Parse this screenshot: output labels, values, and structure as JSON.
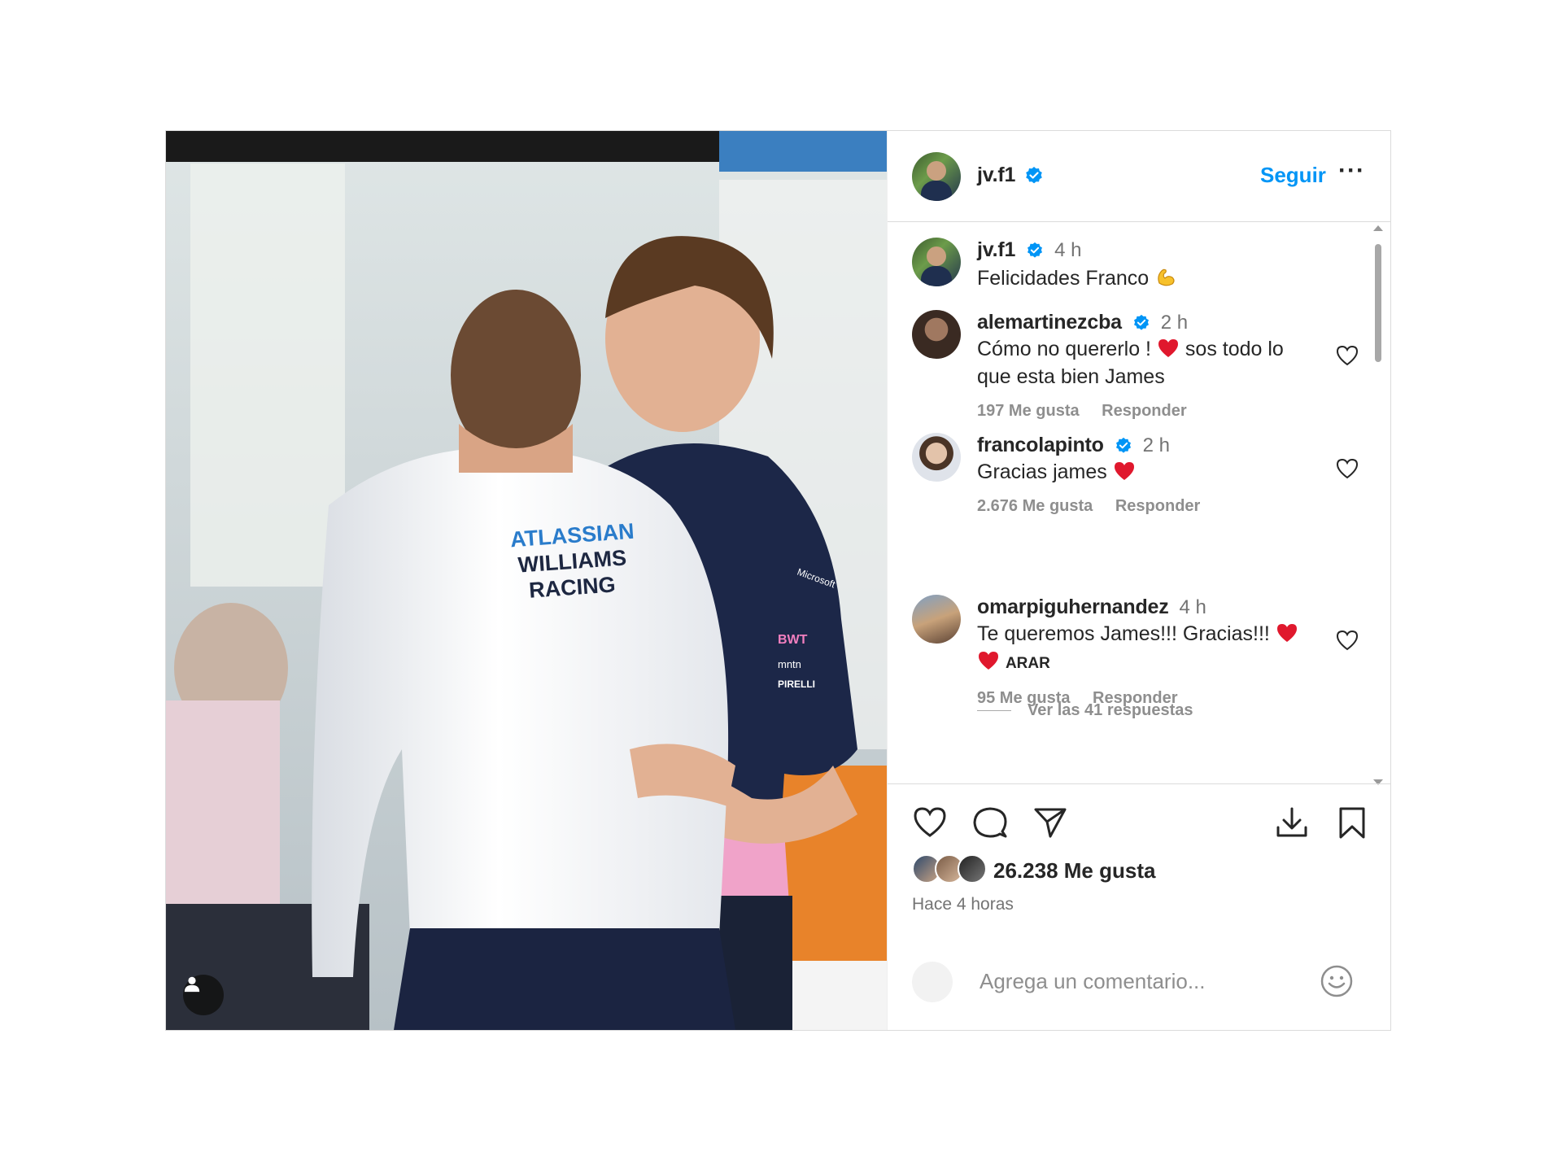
{
  "photo": {
    "shirt_text": [
      "ATLASSIAN",
      "WILLIAMS",
      "RACING"
    ],
    "sponsor_text": [
      "Microsoft",
      "BWT",
      "mntn",
      "PIRELLI"
    ],
    "tag_icon": "user-tag-icon"
  },
  "header": {
    "username": "jv.f1",
    "verified": true,
    "follow_label": "Seguir",
    "more_label": "···"
  },
  "caption": {
    "username": "jv.f1",
    "time": "4 h",
    "text": "Felicidades Franco",
    "emoji": "flexed-biceps-icon"
  },
  "comments": [
    {
      "username": "alemartinezcba",
      "verified": true,
      "time": "2 h",
      "text_part1": "Cómo no quererlo !",
      "text_part2": "sos todo lo",
      "text_line2": "que esta bien James",
      "likes": "197 Me gusta",
      "reply": "Responder"
    },
    {
      "username": "francolapinto",
      "verified": true,
      "time": "2 h",
      "text": "Gracias james",
      "likes": "2.676 Me gusta",
      "reply": "Responder",
      "view_replies": "Ver las 41 respuestas"
    },
    {
      "username": "omarpiguhernandez",
      "verified": false,
      "time": "4 h",
      "text": "Te queremos James!!! Gracias!!!",
      "text_line2": "ARAR",
      "likes": "95 Me gusta",
      "reply": "Responder"
    }
  ],
  "actions": {
    "icons": [
      "heart-icon",
      "comment-icon",
      "share-icon",
      "download-icon",
      "bookmark-icon"
    ],
    "likes": "26.238 Me gusta",
    "posted": "Hace 4 horas"
  },
  "add_comment": {
    "placeholder": "Agrega un comentario..."
  },
  "colors": {
    "accent": "#0095f6",
    "verified": "#0095f6",
    "heart_red": "#e0182d",
    "muted": "#8e8e8e",
    "border": "#dbdbdb"
  }
}
